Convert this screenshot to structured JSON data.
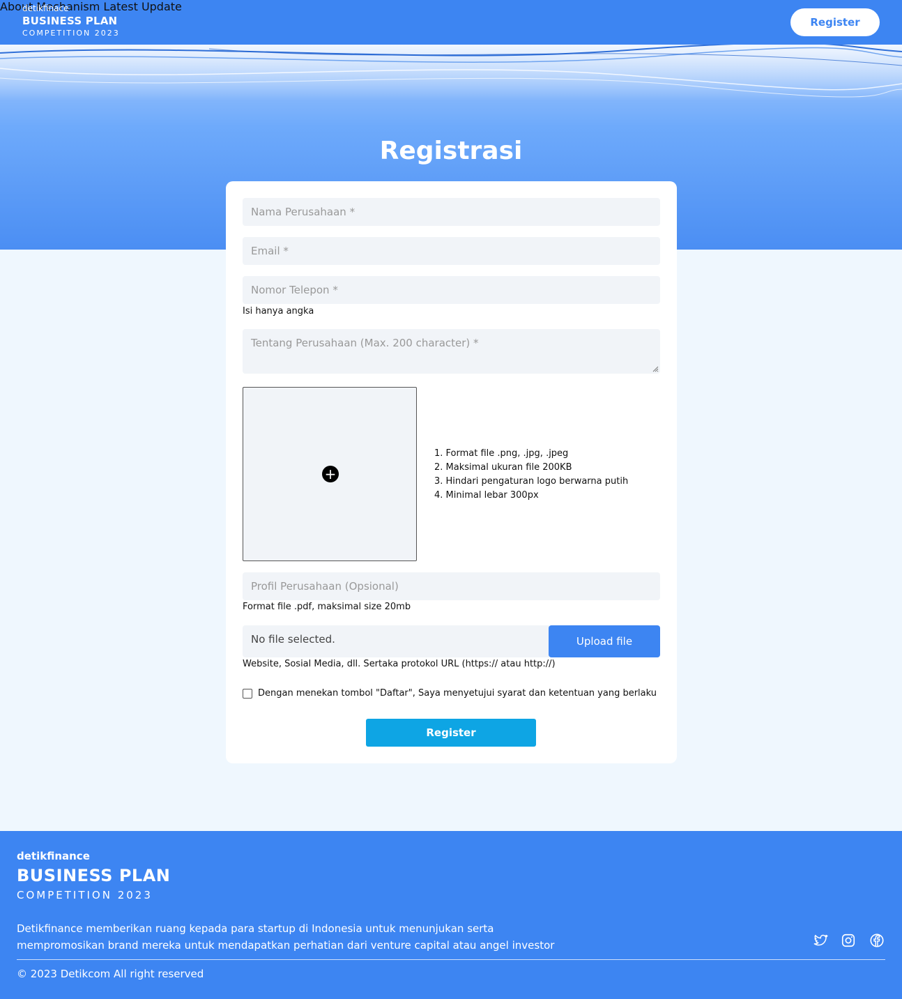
{
  "header": {
    "brand_small": "detikfinace",
    "brand_main": "BUSINESS PLAN",
    "brand_sub": "COMPETITION 2023",
    "nav": [
      "About",
      "Mechanism",
      "Latest Update"
    ],
    "register_label": "Register"
  },
  "hero": {
    "title": "Registrasi"
  },
  "form": {
    "company_name_placeholder": "Nama Perusahaan *",
    "email_placeholder": "Email *",
    "phone_placeholder": "Nomor Telepon *",
    "phone_hint": "Isi hanya angka",
    "about_placeholder": "Tentang Perusahaan (Max. 200 character) *",
    "logo_rules": [
      "1. Format file .png, .jpg, .jpeg",
      "2. Maksimal ukuran file 200KB",
      "3. Hindari pengaturan logo berwarna putih",
      "4. Minimal lebar 300px"
    ],
    "profile_placeholder": "Profil Perusahaan (Opsional)",
    "profile_hint": "Format file .pdf, maksimal size 20mb",
    "file_status": "No file selected.",
    "upload_label": "Upload file",
    "url_hint": "Website, Sosial Media, dll. Sertaka protokol URL (https:// atau http://)",
    "agree_label": "Dengan menekan tombol \"Daftar\", Saya menyetujui syarat dan ketentuan yang berlaku",
    "submit_label": "Register"
  },
  "footer": {
    "brand_small": "detikfinance",
    "brand_main": "BUSINESS PLAN",
    "brand_sub": "COMPETITION 2023",
    "description": "Detikfinance memberikan ruang kepada para startup di Indonesia untuk menunjukan serta mempromosikan brand mereka untuk mendapatkan perhatian dari venture capital atau angel investor",
    "copyright": "© 2023 Detikcom All right reserved",
    "social_icons": [
      "twitter-icon",
      "instagram-icon",
      "facebook-icon"
    ]
  },
  "colors": {
    "primary": "#3d85f2",
    "submit": "#0ea5e4",
    "background": "#eff7fe",
    "field": "#f1f4f8"
  }
}
